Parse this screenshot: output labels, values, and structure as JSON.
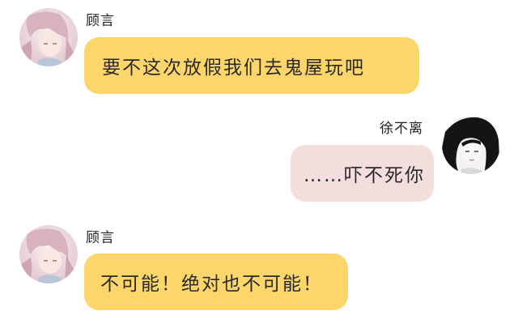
{
  "colors": {
    "left_bubble": "#fcd66a",
    "right_bubble": "#f4dedd",
    "background": "#ffffff"
  },
  "messages": [
    {
      "side": "left",
      "sender": "顾言",
      "avatar": "anime-girl-pink-avatar",
      "text": "要不这次放假我们去鬼屋玩吧"
    },
    {
      "side": "right",
      "sender": "徐不离",
      "avatar": "anime-girl-monochrome-avatar",
      "text": "……吓不死你"
    },
    {
      "side": "left",
      "sender": "顾言",
      "avatar": "anime-girl-pink-avatar",
      "text": "不可能！绝对也不可能！"
    }
  ]
}
